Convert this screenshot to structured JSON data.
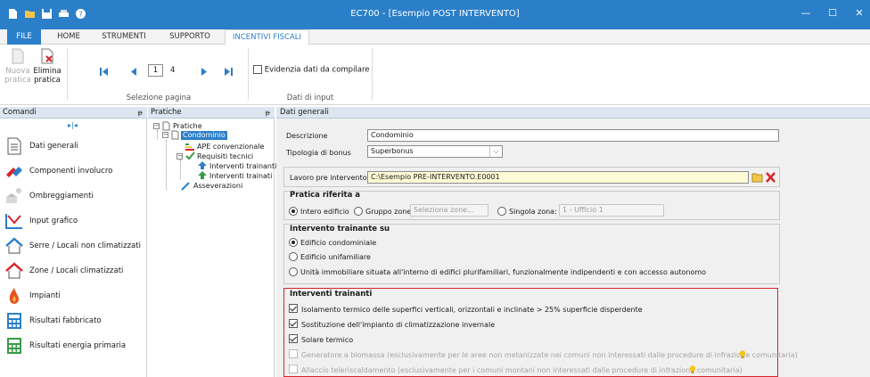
{
  "window": {
    "title": "EC700 - [Esempio POST INTERVENTO]",
    "minimize": "—",
    "maximize": "☐",
    "close": "✕"
  },
  "ribbon_tabs": [
    "FILE",
    "HOME",
    "STRUMENTI",
    "SUPPORTO",
    "INCENTIVI FISCALI"
  ],
  "ribbon": {
    "new_label_1": "Nuova",
    "new_label_2": "pratica",
    "delete_label_1": "Elimina",
    "delete_label_2": "pratica",
    "page_current": "1",
    "page_total": "4",
    "group_page": "Selezione pagina",
    "evidence_label": "Evidenzia dati da compilare",
    "group_input": "Dati di input"
  },
  "panels": {
    "commands_title": "Comandi",
    "tree_title": "Pratiche",
    "main_title": "Dati generali",
    "pin": "ᵽ"
  },
  "commands": [
    {
      "label": "Dati generali",
      "icon": "document-icon"
    },
    {
      "label": "Componenti involucro",
      "icon": "wall-icon"
    },
    {
      "label": "Ombreggiamenti",
      "icon": "shading-icon"
    },
    {
      "label": "Input grafico",
      "icon": "graphic-input-icon"
    },
    {
      "label": "Serre / Locali non climatizzati",
      "icon": "house-icon"
    },
    {
      "label": "Zone / Locali climatizzati",
      "icon": "house-red-icon"
    },
    {
      "label": "Impianti",
      "icon": "flame-icon"
    },
    {
      "label": "Risultati fabbricato",
      "icon": "calculator-icon"
    },
    {
      "label": "Risultati energia primaria",
      "icon": "calculator-icon"
    }
  ],
  "tree": {
    "root": "Pratiche",
    "selected": "Condominio",
    "ape": "APE convenzionale",
    "requisiti": "Requisiti tecnici",
    "trainanti": "Interventi trainanti",
    "trainati": "Interventi trainati",
    "asseverazioni": "Asseverazioni"
  },
  "form": {
    "descrizione_label": "Descrizione",
    "descrizione_value": "Condominio",
    "tipologia_label": "Tipologia di bonus",
    "tipologia_value": "Superbonus",
    "lavoro_label": "Lavoro pre intervento:",
    "lavoro_value": "C:\\Esempio PRE-INTERVENTO.E0001",
    "pratica_title": "Pratica riferita a",
    "intero": "Intero edificio",
    "gruppo": "Gruppo zone",
    "gruppo_placeholder": "Seleziona zone...",
    "singola": "Singola zona:",
    "singola_value": "1 - Ufficio 1",
    "intervento_title": "Intervento trainante su",
    "edificio_cond": "Edificio condominiale",
    "edificio_unif": "Edificio unifamiliare",
    "unita": "Unità immobiliare situata all'interno di edifici plurifamiliari, funzionalmente indipendenti e con accesso autonomo",
    "trainanti_title": "Interventi trainanti",
    "isolamento": "Isolamento termico delle superfici verticali, orizzontali e inclinate > 25% superficie disperdente",
    "sostituzione": "Sostituzione dell'impianto di climatizzazione invernale",
    "solare": "Solare termico",
    "generatore": "Generatore a biomassa (esclusivamente per le aree non metanizzate nei comuni non interessati dalle procedure di infrazione comunitaria)",
    "allaccio": "Allaccio teleriscaldamento (esclusivamente per i comuni montani non interessati dalle procedure di infrazione comunitaria)"
  }
}
